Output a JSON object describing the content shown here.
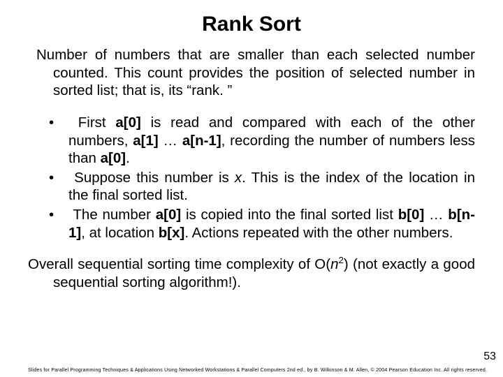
{
  "title": "Rank Sort",
  "intro": "Number of numbers that are smaller than each selected number counted. This count provides the position of selected number in sorted list; that is, its “rank. ”",
  "bullets": [
    {
      "pre": "First ",
      "b1": "a[0]",
      "mid1": " is read and compared with each of the other numbers, ",
      "b2": "a[1]",
      "mid2": " … ",
      "b3": "a[n-1]",
      "mid3": ", recording the number of numbers less than ",
      "b4": "a[0]",
      "post": "."
    },
    {
      "pre": "Suppose this number is ",
      "i1": "x",
      "post": ". This is the index of the location in the final sorted list."
    },
    {
      "pre": "The number ",
      "b1": "a[0]",
      "mid1": " is copied into the final sorted list ",
      "b2": "b[0]",
      "mid2": " … ",
      "b3": "b[n-1]",
      "mid3": ", at location ",
      "b4": "b[x]",
      "post": ". Actions repeated with the other numbers."
    }
  ],
  "closing": {
    "pre": "Overall sequential sorting time complexity of O(",
    "var": "n",
    "sup": "2",
    "post": ") (not exactly a good sequential sorting algorithm!)."
  },
  "pagenum": "53",
  "footer": "Slides for Parallel Programming Techniques & Applications Using Networked Workstations & Parallel Computers 2nd ed., by B. Wilkinson & M. Allen, © 2004 Pearson Education Inc. All rights reserved."
}
